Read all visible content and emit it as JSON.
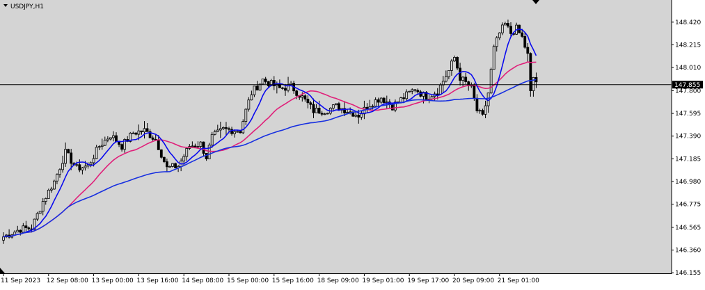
{
  "window": {
    "symbol_label": "USDJPY,H1",
    "menu_icon": "triangle-down-icon",
    "scroll_marker_icon": "triangle-down-icon",
    "corner_marker_icon": "corner-arrow-icon"
  },
  "colors": {
    "background": "#d4d4d4",
    "frame": "#000000",
    "bull_candle": "#000000",
    "bear_candle": "#000000",
    "ma_fast": "#e0207a",
    "ma_medium": "#0a0aee",
    "ma_slow": "#1830e0",
    "price_line": "#000000",
    "price_box": "#000000"
  },
  "chart_data": {
    "type": "candlestick",
    "symbol": "USDJPY",
    "timeframe": "H1",
    "current_price": "147.855",
    "ylim": [
      146.15,
      148.62
    ],
    "y_ticks": [
      "148.420",
      "148.215",
      "148.010",
      "147.800",
      "147.595",
      "147.390",
      "147.185",
      "146.980",
      "146.775",
      "146.565",
      "146.360",
      "146.155"
    ],
    "x_ticks": [
      "11 Sep 2023",
      "12 Sep 08:00",
      "13 Sep 00:00",
      "13 Sep 16:00",
      "14 Sep 08:00",
      "15 Sep 00:00",
      "15 Sep 16:00",
      "18 Sep 09:00",
      "19 Sep 01:00",
      "19 Sep 17:00",
      "20 Sep 09:00",
      "21 Sep 01:00"
    ],
    "x_tick_bar_index": [
      0,
      16,
      32,
      48,
      64,
      80,
      96,
      112,
      128,
      144,
      160,
      176
    ],
    "bar_count": 190,
    "price_path_anchors": [
      {
        "bar": 0,
        "price": 146.48
      },
      {
        "bar": 6,
        "price": 146.55
      },
      {
        "bar": 10,
        "price": 146.56
      },
      {
        "bar": 14,
        "price": 146.8
      },
      {
        "bar": 18,
        "price": 146.98
      },
      {
        "bar": 22,
        "price": 147.24
      },
      {
        "bar": 26,
        "price": 147.1
      },
      {
        "bar": 30,
        "price": 147.12
      },
      {
        "bar": 34,
        "price": 147.3
      },
      {
        "bar": 38,
        "price": 147.4
      },
      {
        "bar": 42,
        "price": 147.3
      },
      {
        "bar": 46,
        "price": 147.42
      },
      {
        "bar": 50,
        "price": 147.44
      },
      {
        "bar": 54,
        "price": 147.36
      },
      {
        "bar": 58,
        "price": 147.1
      },
      {
        "bar": 62,
        "price": 147.12
      },
      {
        "bar": 66,
        "price": 147.3
      },
      {
        "bar": 70,
        "price": 147.32
      },
      {
        "bar": 72,
        "price": 147.2
      },
      {
        "bar": 74,
        "price": 147.38
      },
      {
        "bar": 78,
        "price": 147.45
      },
      {
        "bar": 84,
        "price": 147.44
      },
      {
        "bar": 86,
        "price": 147.62
      },
      {
        "bar": 88,
        "price": 147.78
      },
      {
        "bar": 92,
        "price": 147.9
      },
      {
        "bar": 98,
        "price": 147.82
      },
      {
        "bar": 102,
        "price": 147.84
      },
      {
        "bar": 106,
        "price": 147.74
      },
      {
        "bar": 110,
        "price": 147.62
      },
      {
        "bar": 114,
        "price": 147.62
      },
      {
        "bar": 118,
        "price": 147.66
      },
      {
        "bar": 122,
        "price": 147.62
      },
      {
        "bar": 126,
        "price": 147.58
      },
      {
        "bar": 130,
        "price": 147.68
      },
      {
        "bar": 134,
        "price": 147.74
      },
      {
        "bar": 138,
        "price": 147.66
      },
      {
        "bar": 142,
        "price": 147.74
      },
      {
        "bar": 146,
        "price": 147.82
      },
      {
        "bar": 150,
        "price": 147.74
      },
      {
        "bar": 154,
        "price": 147.8
      },
      {
        "bar": 158,
        "price": 147.98
      },
      {
        "bar": 160,
        "price": 148.1
      },
      {
        "bar": 162,
        "price": 147.92
      },
      {
        "bar": 166,
        "price": 147.82
      },
      {
        "bar": 168,
        "price": 147.62
      },
      {
        "bar": 170,
        "price": 147.56
      },
      {
        "bar": 172,
        "price": 147.78
      },
      {
        "bar": 174,
        "price": 148.18
      },
      {
        "bar": 176,
        "price": 148.32
      },
      {
        "bar": 178,
        "price": 148.4
      },
      {
        "bar": 180,
        "price": 148.32
      },
      {
        "bar": 182,
        "price": 148.36
      },
      {
        "bar": 184,
        "price": 148.28
      },
      {
        "bar": 186,
        "price": 148.12
      },
      {
        "bar": 187,
        "price": 147.78
      },
      {
        "bar": 188,
        "price": 147.92
      },
      {
        "bar": 189,
        "price": 147.88
      }
    ],
    "series": [
      {
        "name": "",
        "kind": "moving-average",
        "color_key": "ma_fast"
      },
      {
        "name": "",
        "kind": "moving-average",
        "color_key": "ma_medium"
      },
      {
        "name": "",
        "kind": "moving-average",
        "color_key": "ma_slow"
      }
    ]
  }
}
